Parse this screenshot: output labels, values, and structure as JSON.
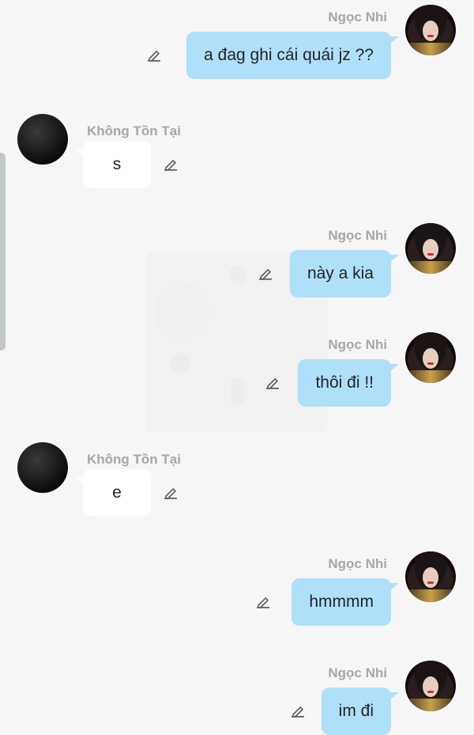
{
  "messages": [
    {
      "sender": "Ngọc Nhi",
      "text": "a đag ghi cái quái jz ??",
      "direction": "out"
    },
    {
      "sender": "Không Tồn Tại",
      "text": "s",
      "direction": "in"
    },
    {
      "sender": "Ngọc Nhi",
      "text": "này a kia",
      "direction": "out"
    },
    {
      "sender": "Ngọc Nhi",
      "text": "thôi đi !!",
      "direction": "out"
    },
    {
      "sender": "Không Tồn Tại",
      "text": "e",
      "direction": "in"
    },
    {
      "sender": "Ngọc Nhi",
      "text": "hmmmm",
      "direction": "out"
    },
    {
      "sender": "Ngọc Nhi",
      "text": "im đi",
      "direction": "out"
    }
  ],
  "icons": {
    "edit": "pencil-icon",
    "avatar_out": "avatar-girl-photo",
    "avatar_in": "avatar-dark-circle"
  },
  "colors": {
    "outgoing_bubble": "#aee0fa",
    "incoming_bubble": "#ffffff",
    "background": "#f6f6f6",
    "sender_name": "#a7a7a7"
  }
}
